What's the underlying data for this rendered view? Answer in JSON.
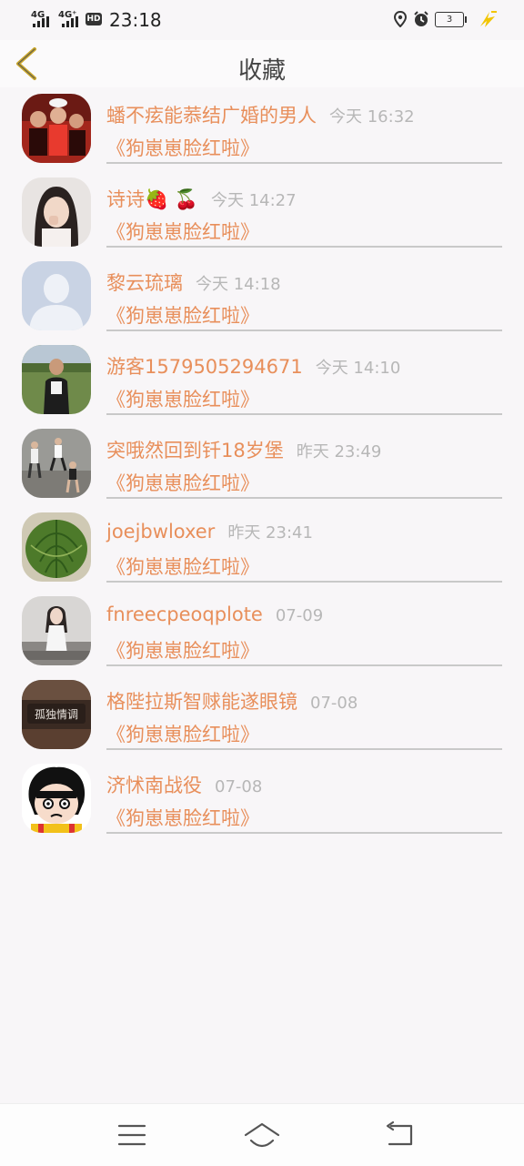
{
  "status_bar": {
    "network1": "4G",
    "network2": "4G⁺",
    "hd": "HD",
    "time": "23:18",
    "battery": "3"
  },
  "header": {
    "title": "收藏"
  },
  "items": [
    {
      "name": "蟠不痃能菾结广婚的男人",
      "time": "今天 16:32",
      "book": "《狗崽崽脸红啦》"
    },
    {
      "name": "诗诗🍓 🍒",
      "time": "今天 14:27",
      "book": "《狗崽崽脸红啦》"
    },
    {
      "name": "黎云琉璃",
      "time": "今天 14:18",
      "book": "《狗崽崽脸红啦》"
    },
    {
      "name": "游客1579505294671",
      "time": "今天 14:10",
      "book": "《狗崽崽脸红啦》"
    },
    {
      "name": "突哦然回到钎18岁堡",
      "time": "昨天 23:49",
      "book": "《狗崽崽脸红啦》"
    },
    {
      "name": "joejbwloxer",
      "time": "昨天 23:41",
      "book": "《狗崽崽脸红啦》"
    },
    {
      "name": "fnreecpeoqplote",
      "time": "07-09",
      "book": "《狗崽崽脸红啦》"
    },
    {
      "name": "格陛拉斯智赇能遂眼镜",
      "time": "07-08",
      "book": "《狗崽崽脸红啦》"
    },
    {
      "name": "济怵南战役",
      "time": "07-08",
      "book": "《狗崽崽脸红啦》"
    }
  ],
  "avatar_texts": {
    "a7": "孤独情调"
  },
  "colors": {
    "accent": "#e88f5b",
    "time": "#b7b7b7",
    "divider": "#c9c9c9",
    "back": "#c9a62a"
  }
}
